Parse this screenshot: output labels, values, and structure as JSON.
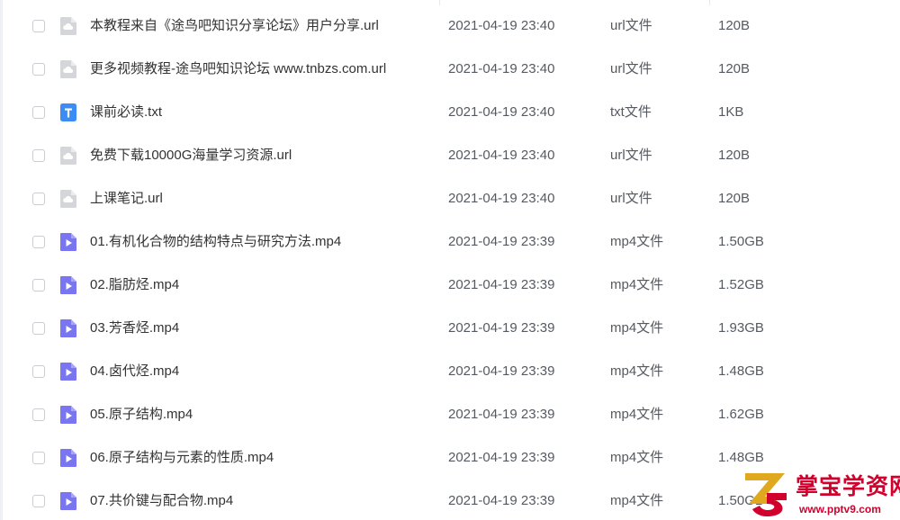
{
  "colors": {
    "text_primary": "#333333",
    "text_secondary": "#555a61",
    "url_icon": "#d4d6da",
    "txt_icon": "#3b8cf5",
    "video_icon": "#7a76f2",
    "watermark_red": "#d1002d"
  },
  "files": [
    {
      "name": "本教程来自《途鸟吧知识分享论坛》用户分享.url",
      "date": "2021-04-19 23:40",
      "type": "url文件",
      "size": "120B",
      "icon": "cloud-link-icon"
    },
    {
      "name": "更多视频教程-途鸟吧知识论坛 www.tnbzs.com.url",
      "date": "2021-04-19 23:40",
      "type": "url文件",
      "size": "120B",
      "icon": "cloud-link-icon"
    },
    {
      "name": "课前必读.txt",
      "date": "2021-04-19 23:40",
      "type": "txt文件",
      "size": "1KB",
      "icon": "text-file-icon"
    },
    {
      "name": "免费下载10000G海量学习资源.url",
      "date": "2021-04-19 23:40",
      "type": "url文件",
      "size": "120B",
      "icon": "cloud-link-icon"
    },
    {
      "name": "上课笔记.url",
      "date": "2021-04-19 23:40",
      "type": "url文件",
      "size": "120B",
      "icon": "cloud-link-icon"
    },
    {
      "name": "01.有机化合物的结构特点与研究方法.mp4",
      "date": "2021-04-19 23:39",
      "type": "mp4文件",
      "size": "1.50GB",
      "icon": "video-file-icon"
    },
    {
      "name": "02.脂肪烃.mp4",
      "date": "2021-04-19 23:39",
      "type": "mp4文件",
      "size": "1.52GB",
      "icon": "video-file-icon"
    },
    {
      "name": "03.芳香烃.mp4",
      "date": "2021-04-19 23:39",
      "type": "mp4文件",
      "size": "1.93GB",
      "icon": "video-file-icon"
    },
    {
      "name": "04.卤代烃.mp4",
      "date": "2021-04-19 23:39",
      "type": "mp4文件",
      "size": "1.48GB",
      "icon": "video-file-icon"
    },
    {
      "name": "05.原子结构.mp4",
      "date": "2021-04-19 23:39",
      "type": "mp4文件",
      "size": "1.62GB",
      "icon": "video-file-icon"
    },
    {
      "name": "06.原子结构与元素的性质.mp4",
      "date": "2021-04-19 23:39",
      "type": "mp4文件",
      "size": "1.48GB",
      "icon": "video-file-icon"
    },
    {
      "name": "07.共价键与配合物.mp4",
      "date": "2021-04-19 23:39",
      "type": "mp4文件",
      "size": "1.50GB",
      "icon": "video-file-icon"
    }
  ],
  "watermark": {
    "title": "掌宝学资网",
    "url": "www.pptv9.com",
    "logo_icon": "zb-logo-icon"
  }
}
